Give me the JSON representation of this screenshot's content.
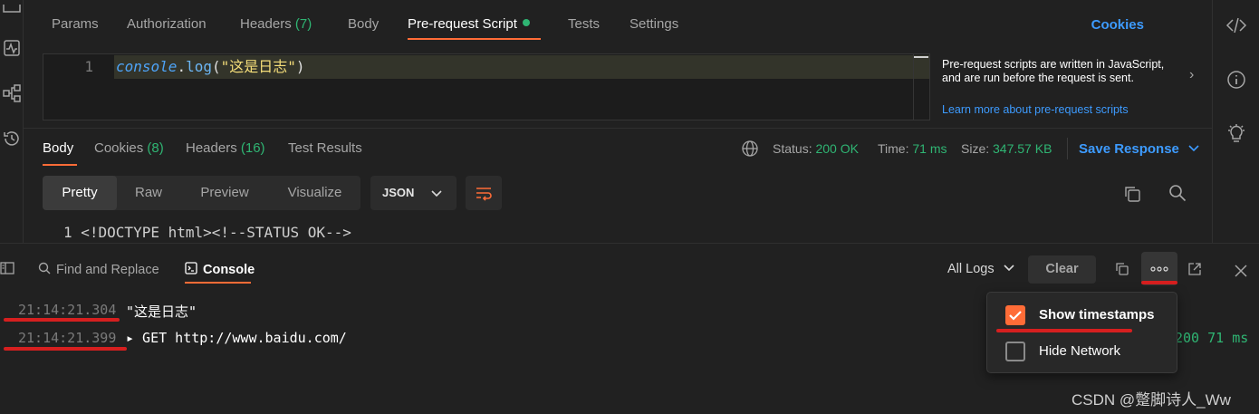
{
  "request_tabs": {
    "params": "Params",
    "authorization": "Authorization",
    "headers_label": "Headers",
    "headers_count": "(7)",
    "body": "Body",
    "prerequest": "Pre-request Script",
    "tests": "Tests",
    "settings": "Settings",
    "cookies": "Cookies"
  },
  "editor": {
    "line_number": "1",
    "code_obj": "console",
    "code_dot": ".",
    "code_fn": "log",
    "code_open": "(",
    "code_str": "\"这是日志\"",
    "code_close": ")"
  },
  "hint": {
    "text": "Pre-request scripts are written in JavaScript, and are run before the request is sent.",
    "link": "Learn more about pre-request scripts"
  },
  "response_tabs": {
    "body": "Body",
    "cookies_label": "Cookies",
    "cookies_count": "(8)",
    "headers_label": "Headers",
    "headers_count": "(16)",
    "test_results": "Test Results"
  },
  "response_status": {
    "status_label": "Status:",
    "status_value": "200 OK",
    "time_label": "Time:",
    "time_value": "71 ms",
    "size_label": "Size:",
    "size_value": "347.57 KB",
    "save_response": "Save Response"
  },
  "view_modes": [
    "Pretty",
    "Raw",
    "Preview",
    "Visualize"
  ],
  "format": "JSON",
  "response_peek": "1    <!DOCTYPE html><!--STATUS OK-->",
  "console_bar": {
    "find_replace": "Find and Replace",
    "console": "Console",
    "all_logs": "All Logs",
    "clear": "Clear"
  },
  "logs": [
    {
      "timestamp": "21:14:21.304",
      "text": "\"这是日志\"",
      "status": ""
    },
    {
      "timestamp": "21:14:21.399",
      "text": "▸ GET http://www.baidu.com/",
      "status": "200   71 ms"
    }
  ],
  "dropdown": {
    "show_timestamps": "Show timestamps",
    "hide_network": "Hide Network",
    "show_timestamps_checked": true,
    "hide_network_checked": false
  },
  "watermark": "CSDN @蹩脚诗人_Ww",
  "colors": {
    "accent": "#ff6c37",
    "link": "#3d9bff",
    "success": "#2fb573",
    "annotation": "#d61f1f"
  }
}
